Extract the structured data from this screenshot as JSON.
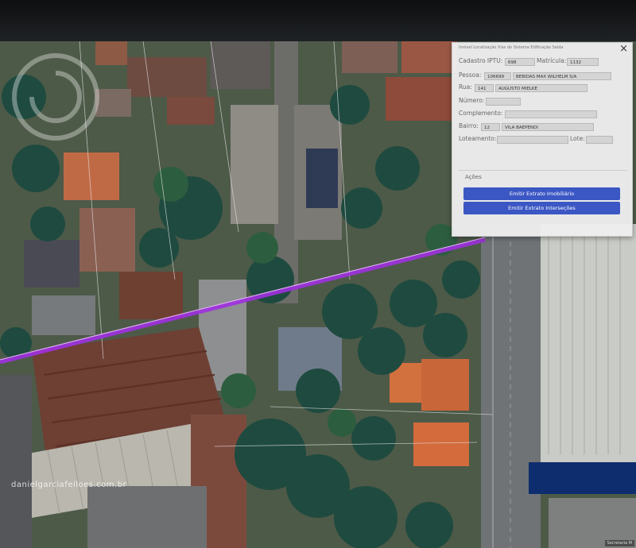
{
  "panel": {
    "title": "Imóvel Localização Vias do Sistema Edificação Saída",
    "close_label": "×",
    "fields": {
      "cadastro_iptu_label": "Cadastro IPTU:",
      "cadastro_iptu_value": "698",
      "matricula_label": "Matrícula:",
      "matricula_value": "1132",
      "pessoa_label": "Pessoa:",
      "pessoa_code": "106699",
      "pessoa_name": "BEBIDAS MAX WILHELM S/A",
      "rua_label": "Rua:",
      "rua_code": "141",
      "rua_name": "AUGUSTO MIELKE",
      "numero_label": "Número:",
      "numero_value": "",
      "complemento_label": "Complemento:",
      "complemento_value": "",
      "bairro_label": "Bairro:",
      "bairro_code": "12",
      "bairro_name": "VILA BAEPENDI",
      "loteamento_label": "Loteamento:",
      "loteamento_value": "",
      "lote_label": "Lote:",
      "lote_value": ""
    },
    "actions_label": "Ações",
    "btn_imobiliario": "Emitir Extrato Imobiliário",
    "btn_intersecoes": "Emitir Extrato Interseções",
    "accent": "#3b57c4"
  },
  "watermark": "danielgarciafeiloes.com.br",
  "map_credit": "Secretaria M"
}
